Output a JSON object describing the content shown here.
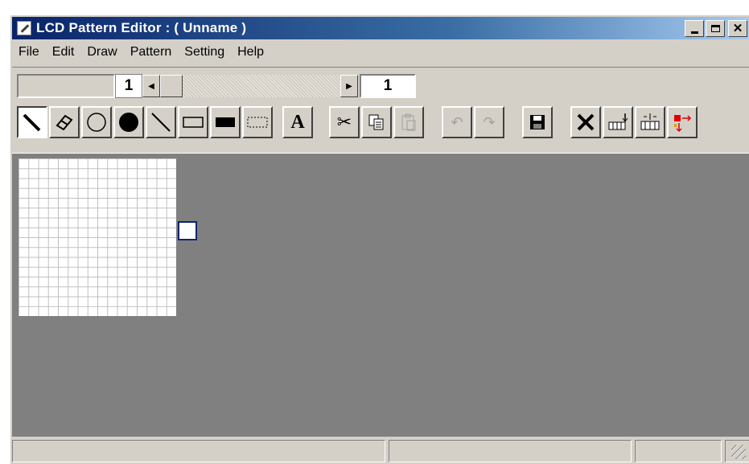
{
  "window": {
    "title": "LCD Pattern Editor : ( Unname )",
    "app_icon": "pencil-app-icon",
    "controls": [
      "minimize-icon",
      "maximize-icon",
      "close-icon"
    ]
  },
  "menu": {
    "items": [
      "File",
      "Edit",
      "Draw",
      "Pattern",
      "Setting",
      "Help"
    ]
  },
  "toolbar": {
    "frame_value": "1",
    "page_value": "1",
    "tools": [
      {
        "name": "pencil-tool",
        "icon": "pencil-icon",
        "selected": true
      },
      {
        "name": "eraser-tool",
        "icon": "eraser-icon"
      },
      {
        "name": "circle-tool",
        "icon": "circle-outline-icon"
      },
      {
        "name": "filled-circle-tool",
        "icon": "filled-circle-icon"
      },
      {
        "name": "line-tool",
        "icon": "line-icon"
      },
      {
        "name": "rectangle-tool",
        "icon": "rectangle-outline-icon"
      },
      {
        "name": "filled-rectangle-tool",
        "icon": "filled-rectangle-icon"
      },
      {
        "name": "select-tool",
        "icon": "dotted-selection-icon"
      },
      {
        "name": "text-tool",
        "icon": "text-a-icon",
        "label": "A"
      },
      {
        "name": "cut-button",
        "icon": "scissors-icon"
      },
      {
        "name": "copy-button",
        "icon": "copy-icon"
      },
      {
        "name": "paste-button",
        "icon": "paste-icon",
        "disabled": true
      },
      {
        "name": "undo-button",
        "icon": "undo-icon",
        "disabled": true
      },
      {
        "name": "redo-button",
        "icon": "redo-icon",
        "disabled": true
      },
      {
        "name": "save-button",
        "icon": "floppy-disk-icon"
      },
      {
        "name": "delete-button",
        "icon": "delete-x-icon"
      },
      {
        "name": "insert-down-button",
        "icon": "insert-down-icon"
      },
      {
        "name": "insert-across-button",
        "icon": "insert-across-icon"
      },
      {
        "name": "resize-button",
        "icon": "resize-arrows-icon"
      }
    ]
  },
  "canvas": {
    "grid_columns": 16,
    "grid_rows": 16
  },
  "colors": {
    "face": "#d4d0c8",
    "workspace": "#808080",
    "title_start": "#0a246a",
    "title_end": "#a6caf0"
  }
}
